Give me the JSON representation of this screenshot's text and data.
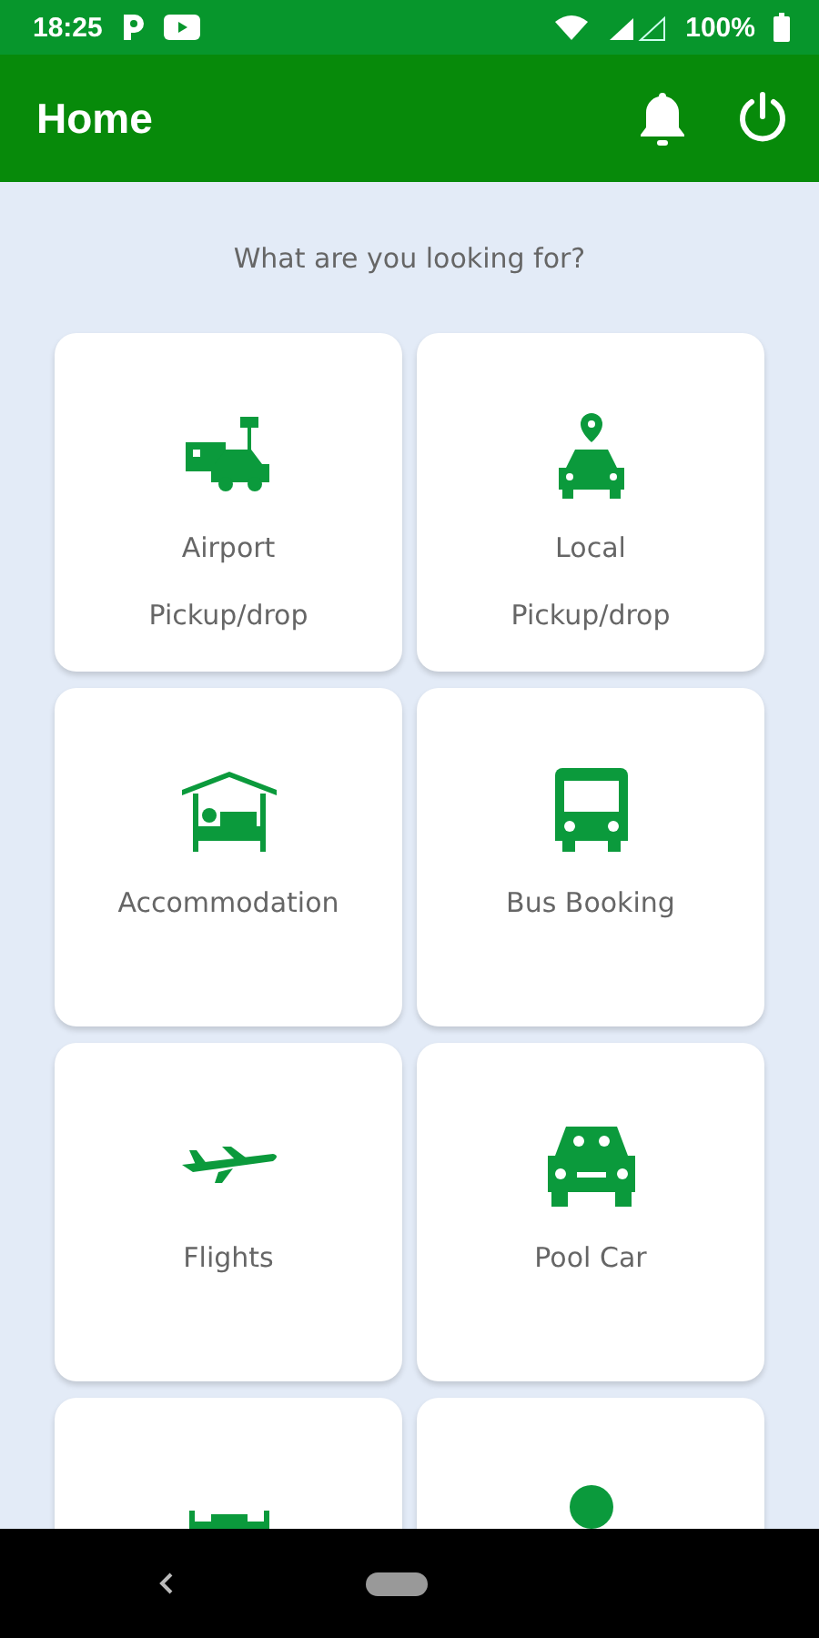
{
  "status_bar": {
    "time": "18:25",
    "battery": "100%"
  },
  "app_bar": {
    "title": "Home"
  },
  "prompt": "What are you looking for?",
  "services": [
    {
      "kind": "airport",
      "lines": [
        "Airport",
        "Pickup/drop"
      ]
    },
    {
      "kind": "taxi",
      "lines": [
        "Local",
        "Pickup/drop"
      ]
    },
    {
      "kind": "hotel",
      "lines": [
        "Accommodation"
      ]
    },
    {
      "kind": "bus",
      "lines": [
        "Bus Booking"
      ]
    },
    {
      "kind": "plane",
      "lines": [
        "Flights"
      ]
    },
    {
      "kind": "car",
      "lines": [
        "Pool Car"
      ]
    },
    {
      "kind": "bench"
    },
    {
      "kind": "dot"
    }
  ]
}
